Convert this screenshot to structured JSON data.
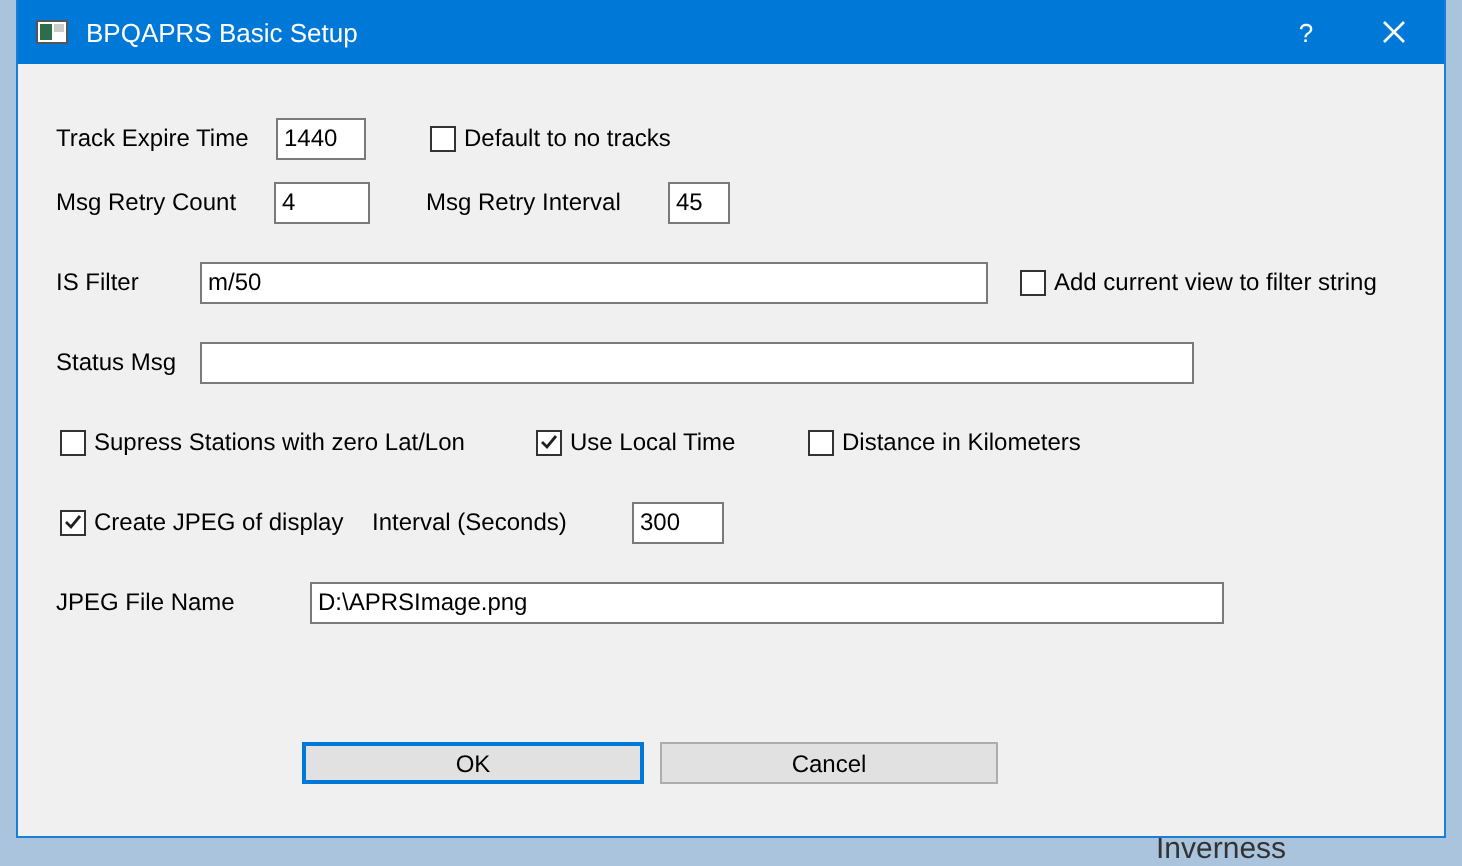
{
  "window": {
    "title": "BPQAPRS Basic Setup",
    "help": "?"
  },
  "rows": [
    {
      "items": [
        {
          "kind": "label",
          "text": "Track Expire Time"
        },
        {
          "kind": "field",
          "value": "1440"
        },
        {
          "kind": "checkbox",
          "label": "Default to no tracks",
          "checked": false
        }
      ]
    },
    {
      "items": [
        {
          "kind": "label",
          "text": "Msg Retry Count"
        },
        {
          "kind": "field",
          "value": "4"
        },
        {
          "kind": "label",
          "text": "Msg Retry Interval"
        },
        {
          "kind": "field",
          "value": "45"
        }
      ]
    },
    {
      "items": [
        {
          "kind": "label",
          "text": "IS Filter"
        },
        {
          "kind": "field",
          "value": "m/50"
        },
        {
          "kind": "checkbox",
          "label": "Add current view to filter string",
          "checked": false
        }
      ]
    },
    {
      "items": [
        {
          "kind": "label",
          "text": "Status Msg"
        },
        {
          "kind": "field",
          "value": ""
        }
      ]
    },
    {
      "items": [
        {
          "kind": "checkbox",
          "label": "Supress Stations with zero Lat/Lon",
          "checked": false
        },
        {
          "kind": "checkbox",
          "label": "Use Local Time",
          "checked": true
        },
        {
          "kind": "checkbox",
          "label": "Distance in Kilometers",
          "checked": false
        }
      ]
    },
    {
      "items": [
        {
          "kind": "checkbox",
          "label": "Create JPEG of display",
          "checked": true
        },
        {
          "kind": "label",
          "text": "Interval (Seconds)"
        },
        {
          "kind": "field",
          "value": "300"
        }
      ]
    },
    {
      "items": [
        {
          "kind": "label",
          "text": "JPEG File Name"
        },
        {
          "kind": "field",
          "value": "D:\\APRSImage.png"
        }
      ]
    }
  ],
  "buttons": [
    {
      "label": "OK",
      "default": true
    },
    {
      "label": "Cancel",
      "default": false
    }
  ],
  "map": {
    "place_label": "Inverness"
  }
}
